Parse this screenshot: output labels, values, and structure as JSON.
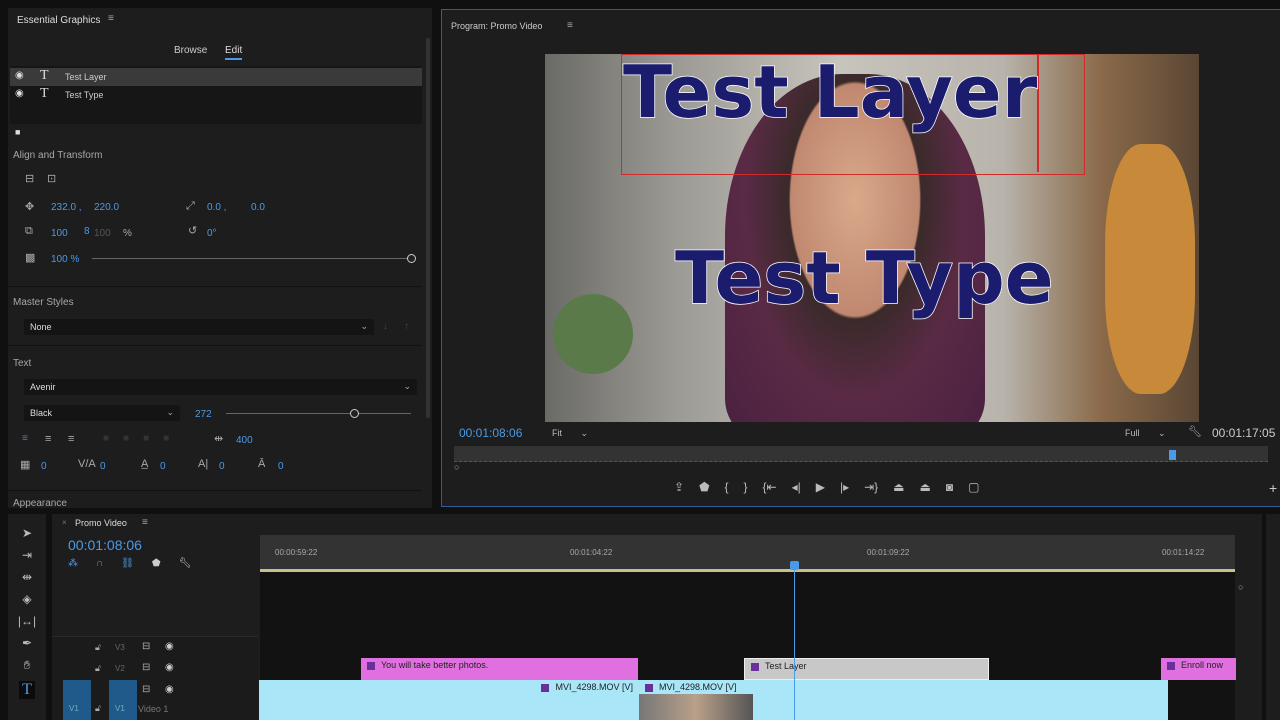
{
  "essential_graphics": {
    "title": "Essential Graphics",
    "tabs": [
      "Browse",
      "Edit"
    ],
    "active_tab": "Edit",
    "layers": [
      {
        "name": "Test Layer",
        "selected": true
      },
      {
        "name": "Test Type",
        "selected": false
      }
    ],
    "align_transform": {
      "label": "Align and Transform",
      "position_x": "232.0 ,",
      "position_y": "220.0",
      "anchor_x": "0.0 ,",
      "anchor_y": "0.0",
      "scale": "100",
      "scale_linked": "100",
      "scale_unit": "%",
      "rotation": "0°",
      "opacity": "100 %"
    },
    "master_styles": {
      "label": "Master Styles",
      "value": "None"
    },
    "text": {
      "label": "Text",
      "font": "Avenir",
      "style": "Black",
      "size": "272",
      "tracking_value": "400",
      "kerning": "0",
      "leading": "0",
      "baseline": "0",
      "tsume": "0",
      "caps": "0"
    },
    "appearance_label": "Appearance"
  },
  "program_monitor": {
    "title": "Program: Promo Video",
    "overlay_text_1": "Test Layer",
    "overlay_text_2": "Test Type",
    "current_time": "00:01:08:06",
    "zoom": "Fit",
    "resolution": "Full",
    "duration": "00:01:17:05"
  },
  "timeline": {
    "title": "Promo Video",
    "timecode": "00:01:08:06",
    "ruler": [
      "00:00:59:22",
      "00:01:04:22",
      "00:01:09:22",
      "00:01:14:22"
    ],
    "tracks": [
      "V3",
      "V2",
      "V1"
    ],
    "track_name": "Video 1",
    "source_patch": "V1",
    "clips": {
      "v2_a": "You will take better photos.",
      "v2_b": "Test Layer",
      "v2_c": "Enroll now",
      "v1_a": "MVI_4298.MOV [V]",
      "v1_b": "MVI_4298.MOV [V]"
    }
  },
  "colors": {
    "accent": "#4a9ae8",
    "pink_clip": "#e070e0",
    "gray_clip": "#c8c8c8",
    "video_clip": "#a8e6f8"
  }
}
